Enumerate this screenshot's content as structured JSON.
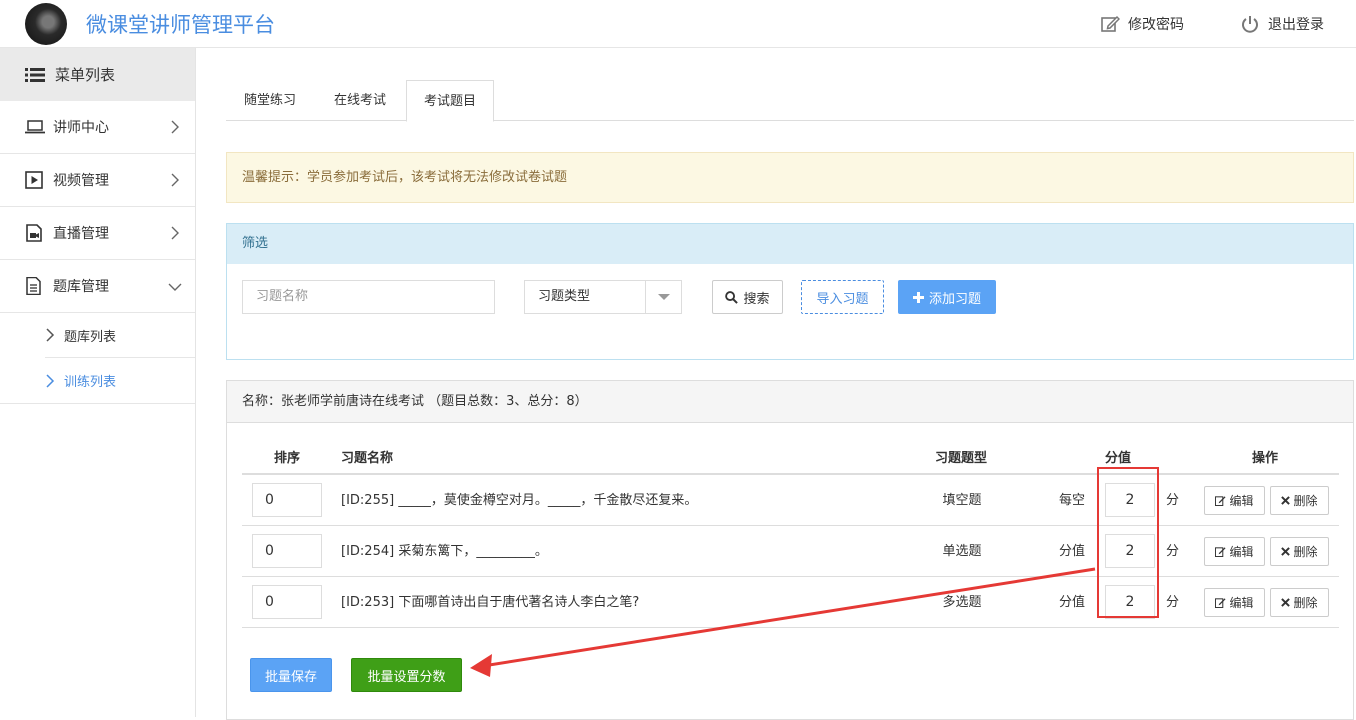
{
  "header": {
    "title": "微课堂讲师管理平台",
    "change_password": "修改密码",
    "logout": "退出登录"
  },
  "sidebar": {
    "menu_title": "菜单列表",
    "items": [
      {
        "label": "讲师中心",
        "icon": "laptop-icon"
      },
      {
        "label": "视频管理",
        "icon": "video-icon"
      },
      {
        "label": "直播管理",
        "icon": "live-icon"
      },
      {
        "label": "题库管理",
        "icon": "document-icon"
      }
    ],
    "subitems": [
      {
        "label": "题库列表"
      },
      {
        "label": "训练列表"
      }
    ]
  },
  "tabs": [
    {
      "label": "随堂练习"
    },
    {
      "label": "在线考试"
    },
    {
      "label": "考试题目",
      "active": true
    }
  ],
  "alert": "温馨提示：学员参加考试后，该考试将无法修改试卷试题",
  "filter": {
    "title": "筛选",
    "name_placeholder": "习题名称",
    "type_select": "习题类型",
    "search_label": "搜索",
    "import_label": "导入习题",
    "add_label": "添加习题"
  },
  "list": {
    "title": "名称：张老师学前唐诗在线考试 （题目总数：3、总分：8）",
    "headers": {
      "sort": "排序",
      "name": "习题名称",
      "type": "习题题型",
      "score": "分值",
      "action": "操作"
    },
    "rows": [
      {
        "sort": "0",
        "name": "[ID:255] _____，莫使金樽空对月。_____，千金散尽还复来。",
        "type": "填空题",
        "score_label": "每空",
        "score": "2",
        "unit": "分",
        "edit": "编辑",
        "del": "删除"
      },
      {
        "sort": "0",
        "name": "[ID:254] 采菊东篱下，_________。",
        "type": "单选题",
        "score_label": "分值",
        "score": "2",
        "unit": "分",
        "edit": "编辑",
        "del": "删除"
      },
      {
        "sort": "0",
        "name": "[ID:253] 下面哪首诗出自于唐代著名诗人李白之笔?",
        "type": "多选题",
        "score_label": "分值",
        "score": "2",
        "unit": "分",
        "edit": "编辑",
        "del": "删除"
      }
    ],
    "batch_save": "批量保存",
    "batch_score": "批量设置分数"
  },
  "colors": {
    "accent": "#4a8de0",
    "primary_button": "#5ba3f5",
    "success_button": "#3f9f17",
    "annotation": "#e53935"
  }
}
